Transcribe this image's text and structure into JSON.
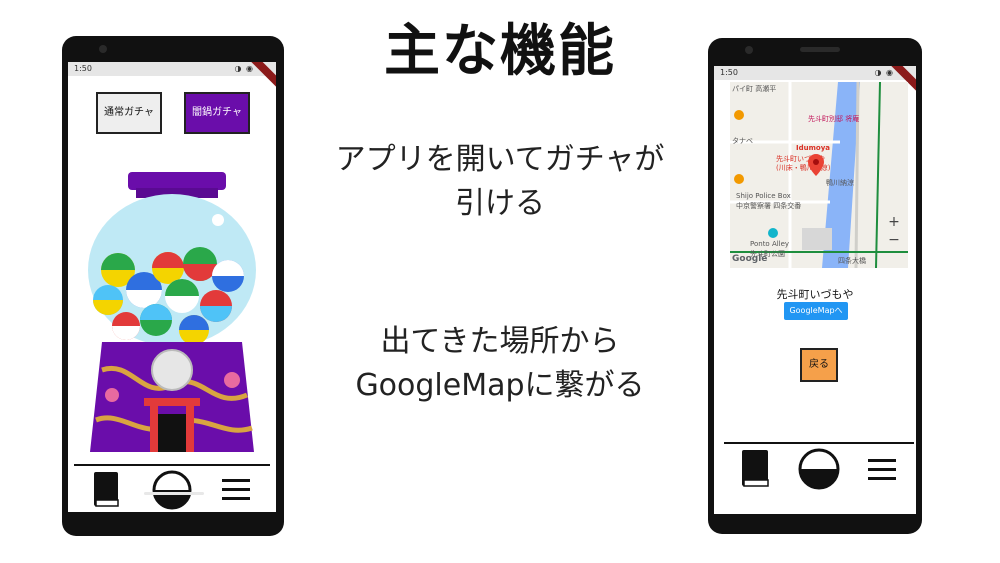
{
  "slide": {
    "title": "主な機能",
    "desc1_line1": "アプリを開いてガチャが",
    "desc1_line2": "引ける",
    "desc2_line1": "出てきた場所から",
    "desc2_line2": "GoogleMapに繋がる"
  },
  "left_phone": {
    "status_time": "1:50",
    "status_icons": "◑ ◉",
    "buttons": {
      "normal_gacha": "通常ガチャ",
      "dark_gacha": "闇鍋ガチャ"
    },
    "nav": [
      "book-icon",
      "gacha-ball-icon",
      "menu-icon"
    ]
  },
  "right_phone": {
    "status_time": "1:50",
    "status_icons": "◑ ◉",
    "map": {
      "labels": {
        "top_left": "パイ町 高瀬平",
        "pontocho": "先斗町別邸 将庵",
        "tanabe": "タナベ",
        "idumoya_en": "Idumoya",
        "idumoya_jp": "先斗町いづもや",
        "idumoya_sub": "(川床・鴨川納涼)",
        "kamogawa": "鴨川納涼",
        "police_en": "Shijo Police Box",
        "police_jp": "中京警察署 四条交番",
        "alley_en": "Ponto Alley",
        "alley_jp": "先斗町公園",
        "street": "四条大橋",
        "google_logo": "Google"
      },
      "zoom_in": "+",
      "zoom_out": "−"
    },
    "place_name": "先斗町いづもや",
    "googlemap_button": "GoogleMapへ",
    "back_button": "戻る",
    "nav": [
      "book-icon",
      "gacha-ball-icon",
      "menu-icon"
    ]
  },
  "colors": {
    "accent_purple": "#6a0daa",
    "google_blue": "#2196f3",
    "back_orange": "#f5a04a",
    "river_blue": "#8ab4f8"
  }
}
